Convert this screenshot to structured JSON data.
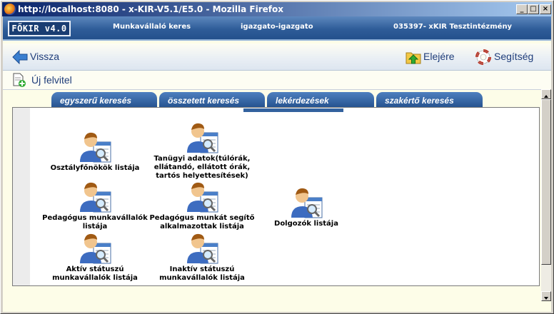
{
  "window": {
    "title": "http://localhost:8080 - x-KIR-V5.1/E5.0 - Mozilla Firefox",
    "controls": [
      "_",
      "□",
      "×"
    ]
  },
  "header": {
    "logo": "FŐKIR v4.0",
    "section": "Munkavállaló keres",
    "user": "igazgato-igazgato",
    "institution": "035397- xKIR Tesztintézmény"
  },
  "nav": {
    "back_label": "Vissza",
    "home_label": "Elejére",
    "help_label": "Segítség"
  },
  "toolbar": {
    "new_record_label": "Új felvitel"
  },
  "tabs": [
    {
      "label": "egyszerű keresés"
    },
    {
      "label": "összetett keresés"
    },
    {
      "label": "lekérdezések"
    },
    {
      "label": "szakértő keresés"
    }
  ],
  "reports": [
    {
      "label": "Osztályfőnökök listája",
      "icon": "user-list-icon"
    },
    {
      "label": "Tanügyi adatok(túlórák,\nellátandó, ellátott órák,\ntartós helyettesítések)",
      "icon": "user-list-icon"
    },
    {
      "label": "Pedagógus munkavállalók\nlistája",
      "icon": "user-list-icon"
    },
    {
      "label": "Pedagógus munkát segítő\nalkalmazottak listája",
      "icon": "user-list-icon"
    },
    {
      "label": "Dolgozók listája",
      "icon": "user-list-icon"
    },
    {
      "label": "Aktív státuszú\nmunkavállalók listája",
      "icon": "user-list-icon"
    },
    {
      "label": "Inaktív státuszú\nmunkavállalók listája",
      "icon": "user-list-icon"
    }
  ],
  "colors": {
    "header_blue": "#2f5d99",
    "nav_text": "#1f3d7a",
    "tab_blue": "#23508c",
    "page_bg": "#fdfde8"
  }
}
